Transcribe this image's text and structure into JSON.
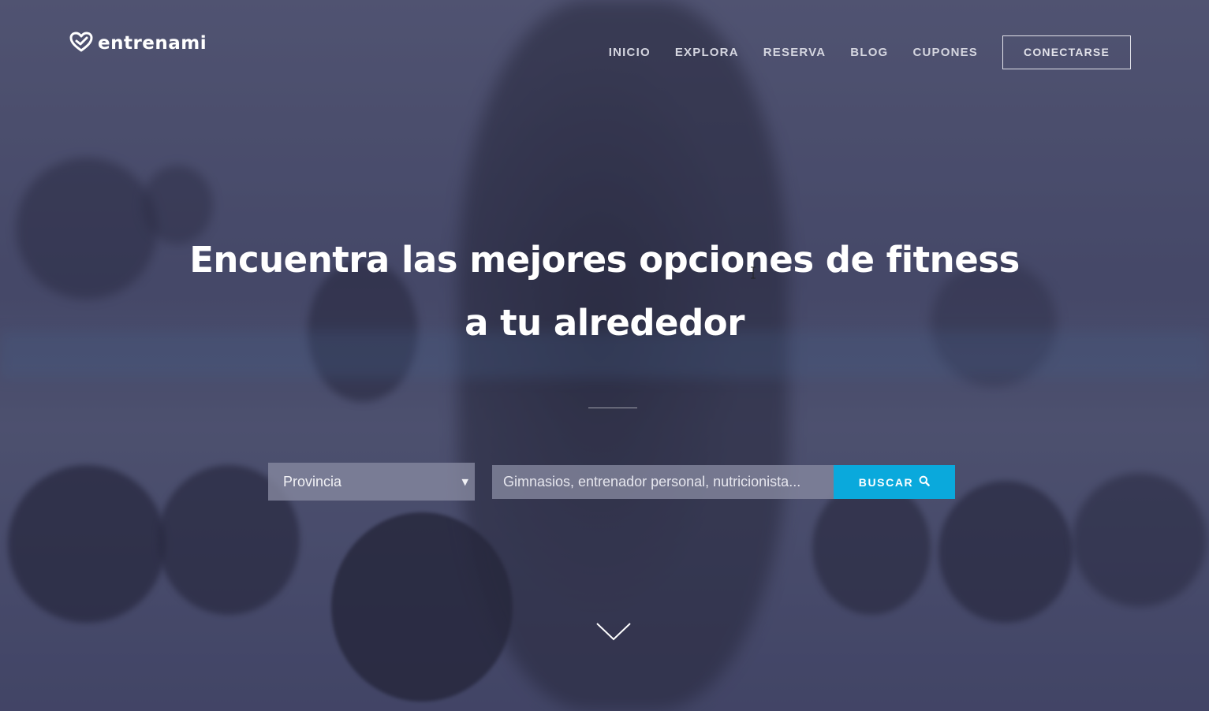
{
  "brand": {
    "name": "entrenami"
  },
  "nav": {
    "items": [
      {
        "label": "INICIO"
      },
      {
        "label": "EXPLORA"
      },
      {
        "label": "RESERVA"
      },
      {
        "label": "BLOG"
      },
      {
        "label": "CUPONES"
      }
    ],
    "login_label": "CONECTARSE"
  },
  "hero": {
    "title_line1": "Encuentra las mejores opciones de fitness",
    "title_line2": "a tu alrededor"
  },
  "search": {
    "province_value": "Provincia",
    "query_placeholder": "Gimnasios, entrenador personal, nutricionista...",
    "button_label": "BUSCAR"
  },
  "colors": {
    "accent": "#0aa9dc",
    "overlay": "#4a4d6d"
  },
  "icons": {
    "logo": "heart-check-icon",
    "search": "magnifier-icon",
    "dropdown": "caret-down-icon",
    "scroll": "chevron-down-icon"
  }
}
